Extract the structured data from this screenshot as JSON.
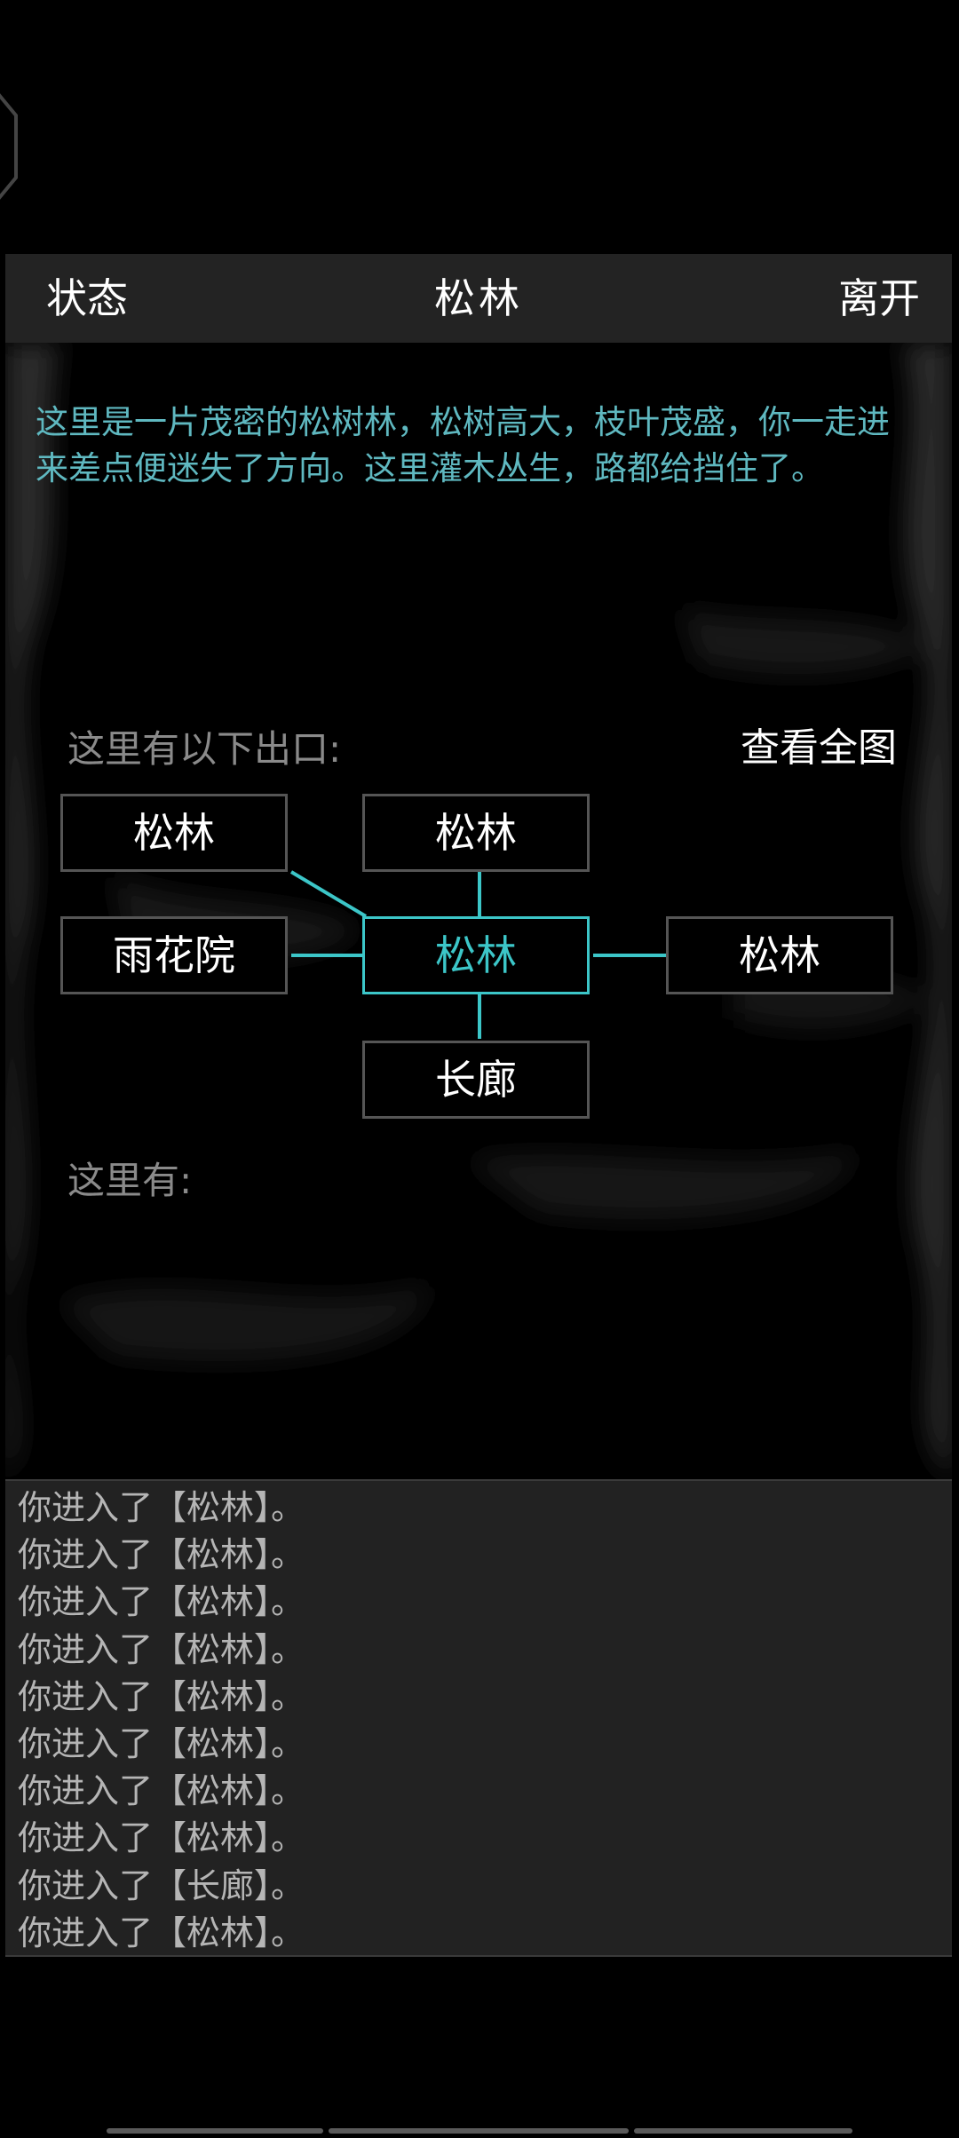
{
  "header": {
    "left_button": "状态",
    "title": "松林",
    "right_button": "离开"
  },
  "room": {
    "description": "这里是一片茂密的松树林，松树高大，枝叶茂盛，你一走进来差点便迷失了方向。这里灌木丛生，路都给挡住了。",
    "exits_label": "这里有以下出口:",
    "view_map_label": "查看全图",
    "here_label": "这里有:"
  },
  "map": {
    "nodes": {
      "northwest": "松林",
      "north": "松林",
      "west": "雨花院",
      "center": "松林",
      "east": "松林",
      "south": "长廊"
    },
    "colors": {
      "current": "#3cc6c8",
      "link": "#3cc6c8",
      "border": "#555555"
    }
  },
  "log": {
    "lines": [
      "你进入了【松林】。",
      "你进入了【松林】。",
      "你进入了【松林】。",
      "你进入了【松林】。",
      "你进入了【松林】。",
      "你进入了【松林】。",
      "你进入了【松林】。",
      "你进入了【松林】。",
      "你进入了【长廊】。",
      "你进入了【松林】。"
    ]
  }
}
